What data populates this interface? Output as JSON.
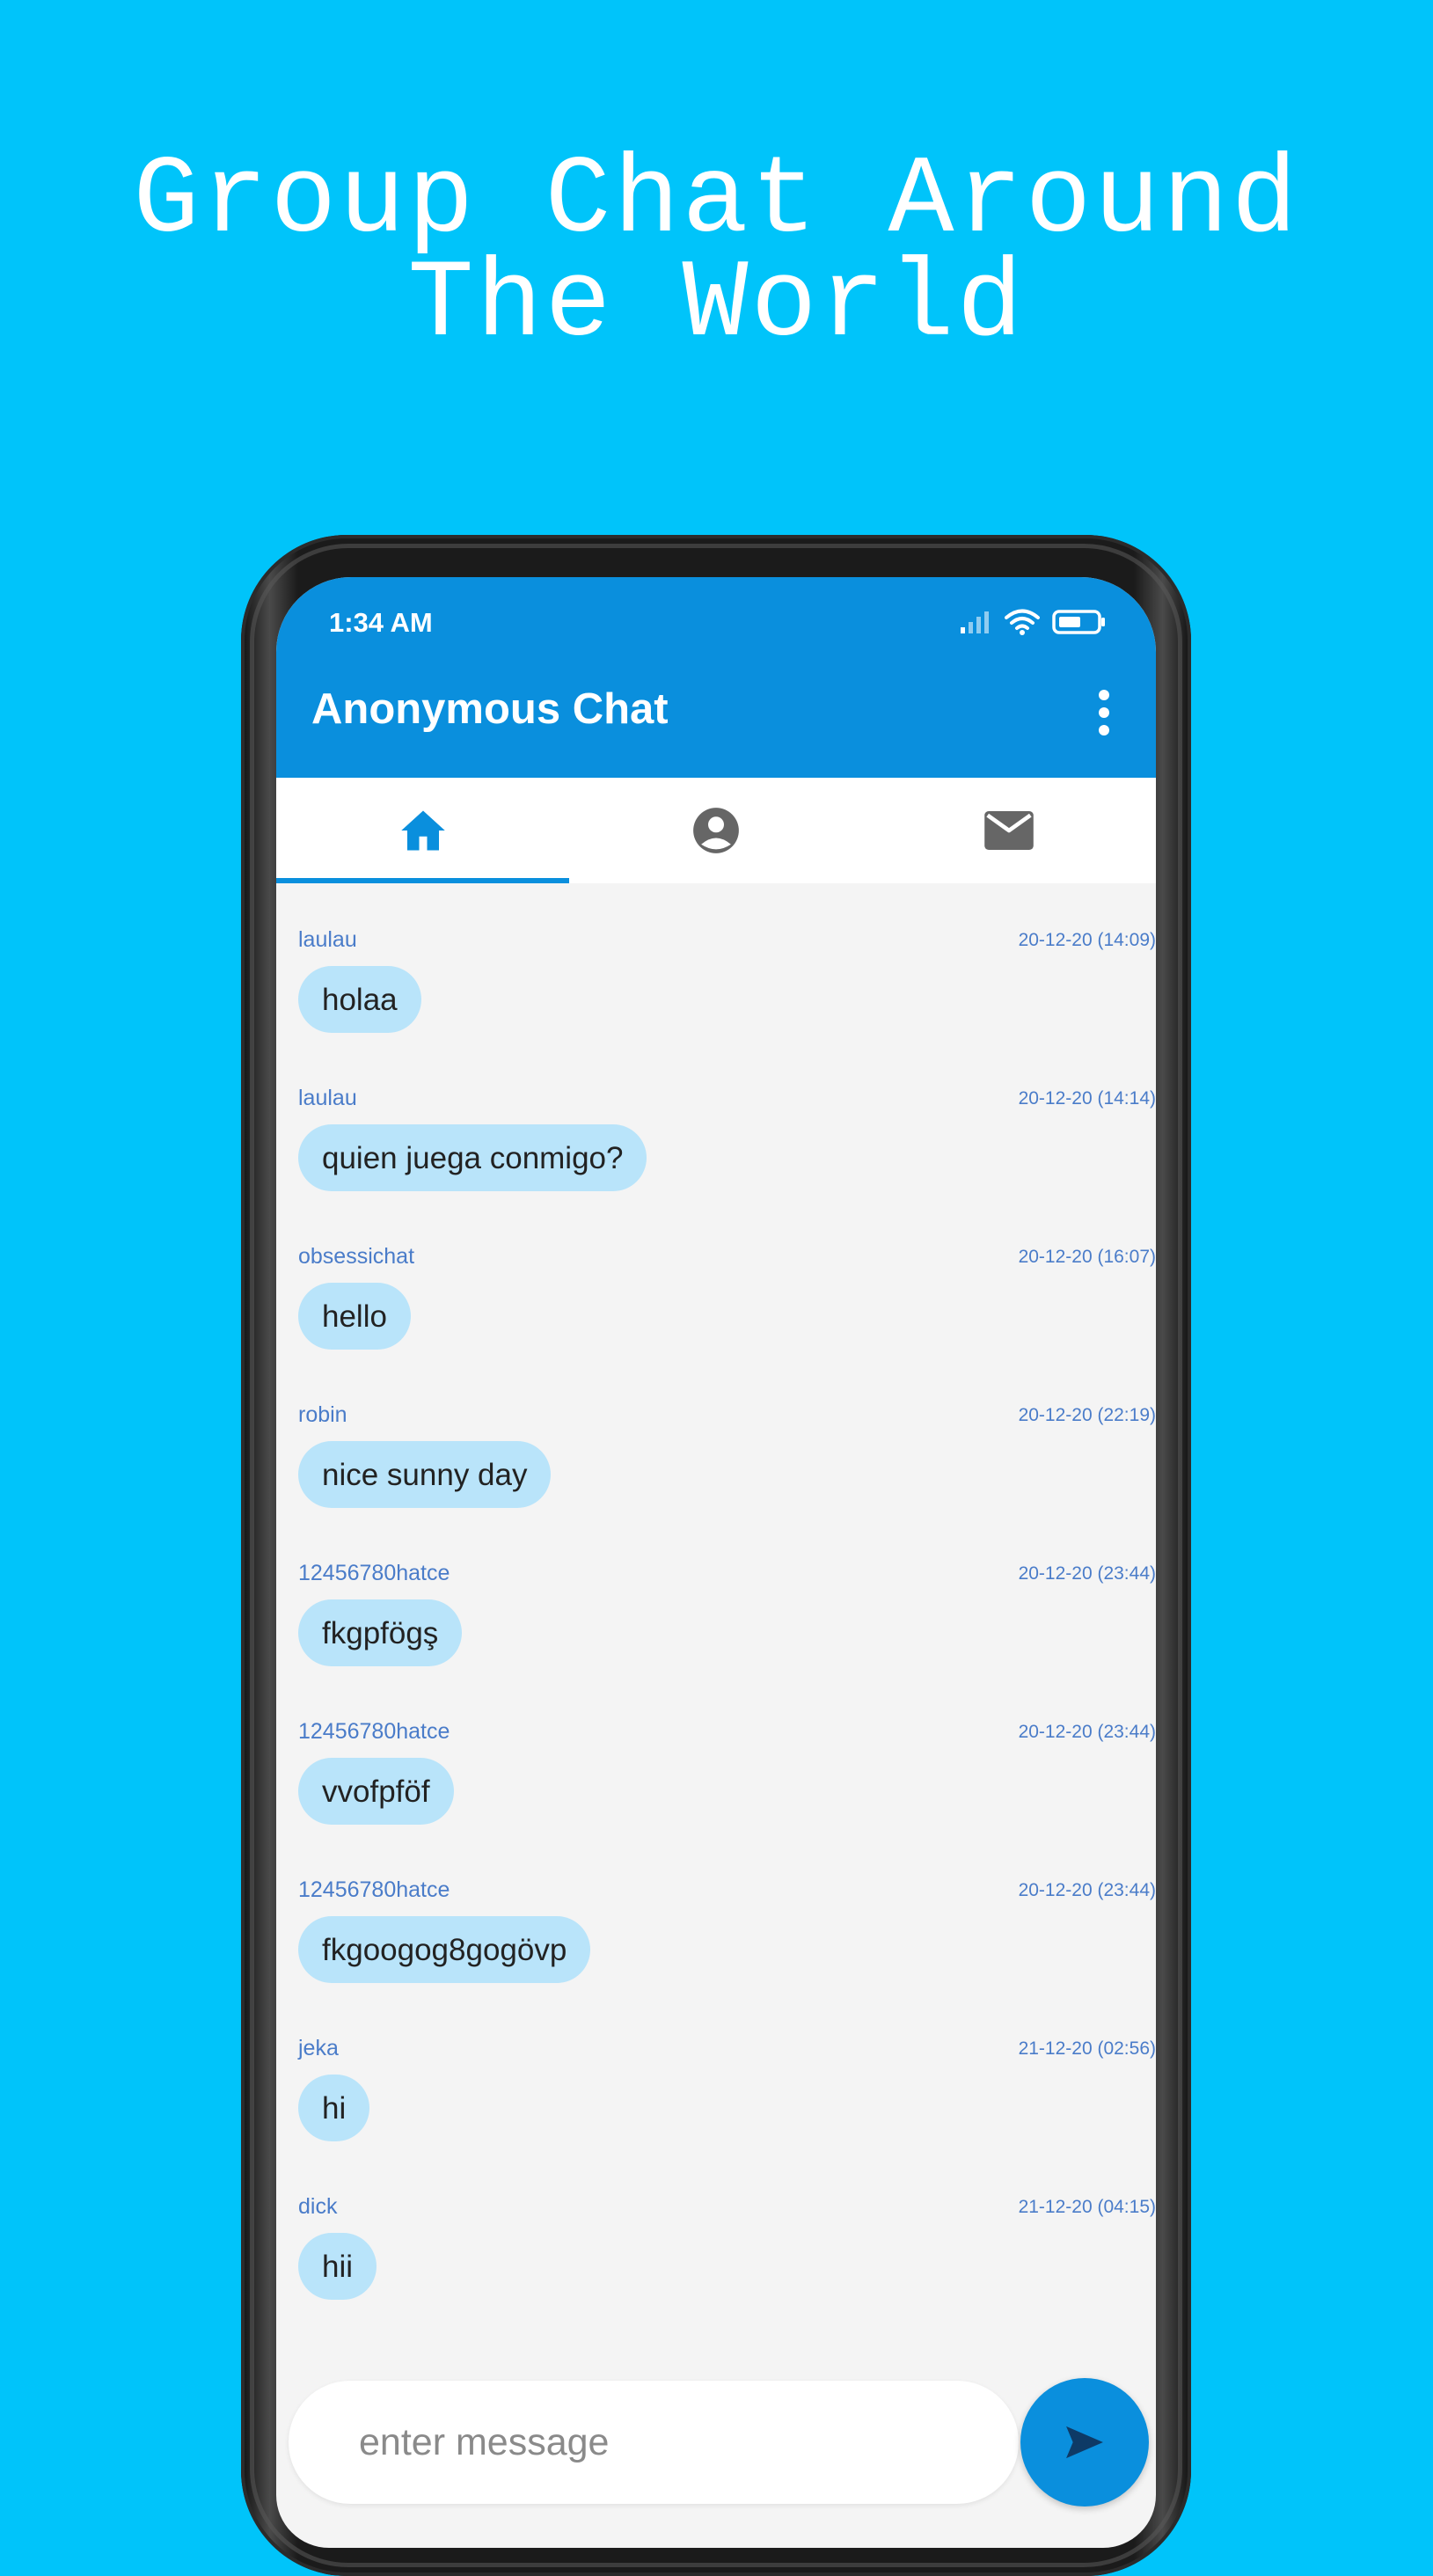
{
  "headline": {
    "line1": "Group Chat Around",
    "line2": "The World"
  },
  "status_bar": {
    "time": "1:34 AM",
    "icons": [
      "signal-icon",
      "wifi-icon",
      "battery-icon"
    ]
  },
  "app_bar": {
    "title": "Anonymous Chat",
    "menu_icon": "more-vert-icon"
  },
  "tabs": [
    {
      "icon": "home-icon",
      "selected": true
    },
    {
      "icon": "account-circle-icon",
      "selected": false
    },
    {
      "icon": "mail-icon",
      "selected": false
    }
  ],
  "messages": [
    {
      "user": "laulau",
      "time": "20-12-20 (14:09)",
      "text": "holaa"
    },
    {
      "user": "laulau",
      "time": "20-12-20 (14:14)",
      "text": "quien juega conmigo?"
    },
    {
      "user": "obsessichat",
      "time": "20-12-20 (16:07)",
      "text": "hello"
    },
    {
      "user": "robin",
      "time": "20-12-20 (22:19)",
      "text": "nice sunny day"
    },
    {
      "user": "12456780hatce",
      "time": "20-12-20 (23:44)",
      "text": "fkgpfögş"
    },
    {
      "user": "12456780hatce",
      "time": "20-12-20 (23:44)",
      "text": "vvofpföf"
    },
    {
      "user": "12456780hatce",
      "time": "20-12-20 (23:44)",
      "text": "fkgoogog8gogövp"
    },
    {
      "user": "jeka",
      "time": "21-12-20 (02:56)",
      "text": "hi"
    },
    {
      "user": "dick",
      "time": "21-12-20 (04:15)",
      "text": "hii"
    }
  ],
  "composer": {
    "placeholder": "enter message",
    "value": "",
    "send_icon": "send-icon"
  },
  "colors": {
    "background": "#00C4FA",
    "primary": "#0A8FDD",
    "bubble": "#B9E4FA",
    "username": "#4A7CC9",
    "chat_background": "#F4F4F4"
  }
}
